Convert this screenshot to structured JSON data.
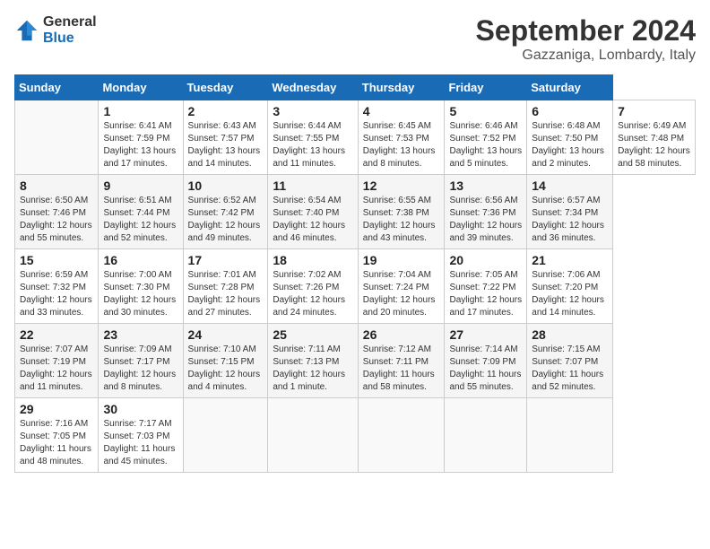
{
  "header": {
    "logo": {
      "general": "General",
      "blue": "Blue"
    },
    "title": "September 2024",
    "location": "Gazzaniga, Lombardy, Italy"
  },
  "calendar": {
    "days_of_week": [
      "Sunday",
      "Monday",
      "Tuesday",
      "Wednesday",
      "Thursday",
      "Friday",
      "Saturday"
    ],
    "weeks": [
      [
        null,
        {
          "day": 1,
          "info": "Sunrise: 6:41 AM\nSunset: 7:59 PM\nDaylight: 13 hours\nand 17 minutes."
        },
        {
          "day": 2,
          "info": "Sunrise: 6:43 AM\nSunset: 7:57 PM\nDaylight: 13 hours\nand 14 minutes."
        },
        {
          "day": 3,
          "info": "Sunrise: 6:44 AM\nSunset: 7:55 PM\nDaylight: 13 hours\nand 11 minutes."
        },
        {
          "day": 4,
          "info": "Sunrise: 6:45 AM\nSunset: 7:53 PM\nDaylight: 13 hours\nand 8 minutes."
        },
        {
          "day": 5,
          "info": "Sunrise: 6:46 AM\nSunset: 7:52 PM\nDaylight: 13 hours\nand 5 minutes."
        },
        {
          "day": 6,
          "info": "Sunrise: 6:48 AM\nSunset: 7:50 PM\nDaylight: 13 hours\nand 2 minutes."
        },
        {
          "day": 7,
          "info": "Sunrise: 6:49 AM\nSunset: 7:48 PM\nDaylight: 12 hours\nand 58 minutes."
        }
      ],
      [
        {
          "day": 8,
          "info": "Sunrise: 6:50 AM\nSunset: 7:46 PM\nDaylight: 12 hours\nand 55 minutes."
        },
        {
          "day": 9,
          "info": "Sunrise: 6:51 AM\nSunset: 7:44 PM\nDaylight: 12 hours\nand 52 minutes."
        },
        {
          "day": 10,
          "info": "Sunrise: 6:52 AM\nSunset: 7:42 PM\nDaylight: 12 hours\nand 49 minutes."
        },
        {
          "day": 11,
          "info": "Sunrise: 6:54 AM\nSunset: 7:40 PM\nDaylight: 12 hours\nand 46 minutes."
        },
        {
          "day": 12,
          "info": "Sunrise: 6:55 AM\nSunset: 7:38 PM\nDaylight: 12 hours\nand 43 minutes."
        },
        {
          "day": 13,
          "info": "Sunrise: 6:56 AM\nSunset: 7:36 PM\nDaylight: 12 hours\nand 39 minutes."
        },
        {
          "day": 14,
          "info": "Sunrise: 6:57 AM\nSunset: 7:34 PM\nDaylight: 12 hours\nand 36 minutes."
        }
      ],
      [
        {
          "day": 15,
          "info": "Sunrise: 6:59 AM\nSunset: 7:32 PM\nDaylight: 12 hours\nand 33 minutes."
        },
        {
          "day": 16,
          "info": "Sunrise: 7:00 AM\nSunset: 7:30 PM\nDaylight: 12 hours\nand 30 minutes."
        },
        {
          "day": 17,
          "info": "Sunrise: 7:01 AM\nSunset: 7:28 PM\nDaylight: 12 hours\nand 27 minutes."
        },
        {
          "day": 18,
          "info": "Sunrise: 7:02 AM\nSunset: 7:26 PM\nDaylight: 12 hours\nand 24 minutes."
        },
        {
          "day": 19,
          "info": "Sunrise: 7:04 AM\nSunset: 7:24 PM\nDaylight: 12 hours\nand 20 minutes."
        },
        {
          "day": 20,
          "info": "Sunrise: 7:05 AM\nSunset: 7:22 PM\nDaylight: 12 hours\nand 17 minutes."
        },
        {
          "day": 21,
          "info": "Sunrise: 7:06 AM\nSunset: 7:20 PM\nDaylight: 12 hours\nand 14 minutes."
        }
      ],
      [
        {
          "day": 22,
          "info": "Sunrise: 7:07 AM\nSunset: 7:19 PM\nDaylight: 12 hours\nand 11 minutes."
        },
        {
          "day": 23,
          "info": "Sunrise: 7:09 AM\nSunset: 7:17 PM\nDaylight: 12 hours\nand 8 minutes."
        },
        {
          "day": 24,
          "info": "Sunrise: 7:10 AM\nSunset: 7:15 PM\nDaylight: 12 hours\nand 4 minutes."
        },
        {
          "day": 25,
          "info": "Sunrise: 7:11 AM\nSunset: 7:13 PM\nDaylight: 12 hours\nand 1 minute."
        },
        {
          "day": 26,
          "info": "Sunrise: 7:12 AM\nSunset: 7:11 PM\nDaylight: 11 hours\nand 58 minutes."
        },
        {
          "day": 27,
          "info": "Sunrise: 7:14 AM\nSunset: 7:09 PM\nDaylight: 11 hours\nand 55 minutes."
        },
        {
          "day": 28,
          "info": "Sunrise: 7:15 AM\nSunset: 7:07 PM\nDaylight: 11 hours\nand 52 minutes."
        }
      ],
      [
        {
          "day": 29,
          "info": "Sunrise: 7:16 AM\nSunset: 7:05 PM\nDaylight: 11 hours\nand 48 minutes."
        },
        {
          "day": 30,
          "info": "Sunrise: 7:17 AM\nSunset: 7:03 PM\nDaylight: 11 hours\nand 45 minutes."
        },
        null,
        null,
        null,
        null,
        null
      ]
    ]
  }
}
